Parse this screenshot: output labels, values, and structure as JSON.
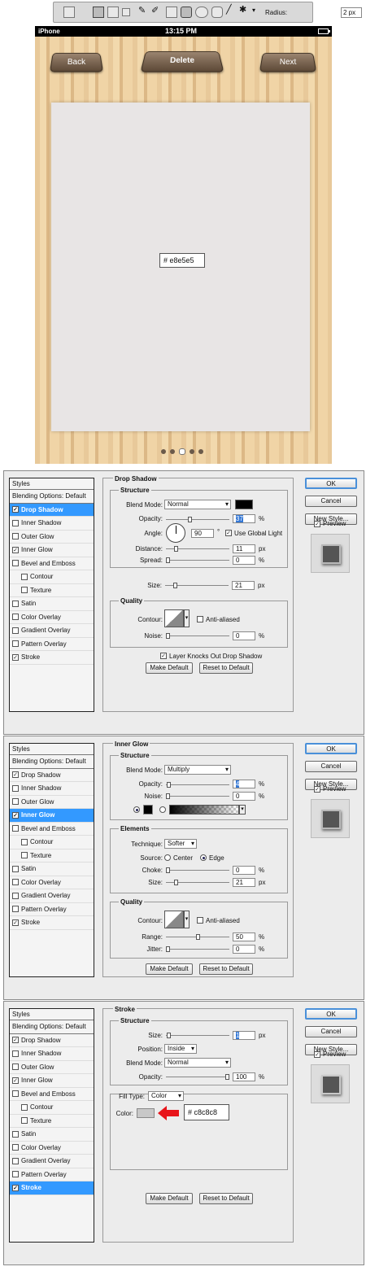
{
  "toolbar": {
    "radius_label": "Radius:",
    "radius_value": "2 px"
  },
  "phone": {
    "carrier": "iPhone",
    "time": "13:15 PM",
    "back": "Back",
    "delete": "Delete",
    "next": "Next",
    "content_color_label": "#  e8e5e5",
    "content_color": "#e8e5e5",
    "page_dots": 5,
    "active_dot": 3
  },
  "common": {
    "styles": "Styles",
    "blending": "Blending Options: Default",
    "items": [
      "Drop Shadow",
      "Inner Shadow",
      "Outer Glow",
      "Inner Glow",
      "Bevel and Emboss",
      "Contour",
      "Texture",
      "Satin",
      "Color Overlay",
      "Gradient Overlay",
      "Pattern Overlay",
      "Stroke"
    ],
    "ok": "OK",
    "cancel": "Cancel",
    "new_style": "New Style...",
    "preview": "Preview",
    "make_default": "Make Default",
    "reset_default": "Reset to Default"
  },
  "dlg1": {
    "title": "Drop Shadow",
    "structure": "Structure",
    "blend_mode_label": "Blend Mode:",
    "blend_mode": "Normal",
    "opacity_label": "Opacity:",
    "opacity": "37",
    "angle_label": "Angle:",
    "angle": "90",
    "global_light": "Use Global Light",
    "distance_label": "Distance:",
    "distance": "11",
    "spread_label": "Spread:",
    "spread": "0",
    "size_label": "Size:",
    "size": "21",
    "quality": "Quality",
    "contour_label": "Contour:",
    "anti_aliased": "Anti-aliased",
    "noise_label": "Noise:",
    "noise": "0",
    "knocks_out": "Layer Knocks Out Drop Shadow"
  },
  "dlg2": {
    "title": "Inner Glow",
    "structure": "Structure",
    "blend_mode_label": "Blend Mode:",
    "blend_mode": "Multiply",
    "opacity_label": "Opacity:",
    "opacity": "4",
    "noise_label": "Noise:",
    "noise": "0",
    "elements": "Elements",
    "technique_label": "Technique:",
    "technique": "Softer",
    "source_label": "Source:",
    "center": "Center",
    "edge": "Edge",
    "choke_label": "Choke:",
    "choke": "0",
    "size_label": "Size:",
    "size": "21",
    "quality": "Quality",
    "contour_label": "Contour:",
    "anti_aliased": "Anti-aliased",
    "range_label": "Range:",
    "range": "50",
    "jitter_label": "Jitter:",
    "jitter": "0"
  },
  "dlg3": {
    "title": "Stroke",
    "structure": "Structure",
    "size_label": "Size:",
    "size": "1",
    "position_label": "Position:",
    "position": "Inside",
    "blend_mode_label": "Blend Mode:",
    "blend_mode": "Normal",
    "opacity_label": "Opacity:",
    "opacity": "100",
    "fill_type_label": "Fill Type:",
    "fill_type": "Color",
    "color_label": "Color:",
    "color_hex_label": "#  c8c8c8",
    "color": "#c8c8c8"
  },
  "units": {
    "pct": "%",
    "px": "px",
    "deg": "°"
  }
}
